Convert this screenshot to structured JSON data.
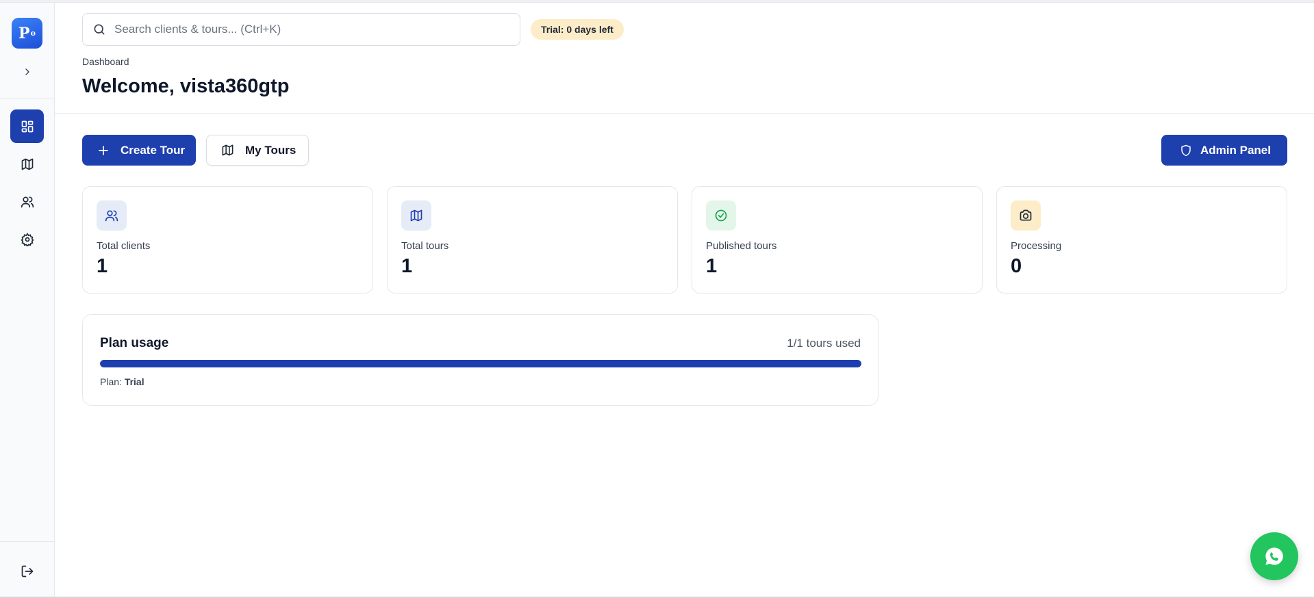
{
  "app": {
    "logo_text": "P",
    "logo_sup": "o"
  },
  "sidebar": {
    "items": [
      {
        "name": "dashboard",
        "icon": "layout-dashboard-icon",
        "active": true
      },
      {
        "name": "tours",
        "icon": "map-icon",
        "active": false
      },
      {
        "name": "clients",
        "icon": "users-icon",
        "active": false
      },
      {
        "name": "settings",
        "icon": "gear-icon",
        "active": false
      }
    ],
    "logout_icon": "log-out-icon"
  },
  "header": {
    "search_placeholder": "Search clients & tours... (Ctrl+K)",
    "search_value": "",
    "trial_badge": "Trial: 0 days left",
    "breadcrumb": "Dashboard",
    "title": "Welcome, vista360gtp"
  },
  "actions": {
    "create_tour": "Create Tour",
    "my_tours": "My Tours",
    "admin_panel": "Admin Panel"
  },
  "stats": [
    {
      "label": "Total clients",
      "value": "1",
      "icon": "users-icon",
      "color": "#1e40af",
      "bg": "#e6ebf8"
    },
    {
      "label": "Total tours",
      "value": "1",
      "icon": "map-icon",
      "color": "#1e40af",
      "bg": "#e6ebf8"
    },
    {
      "label": "Published tours",
      "value": "1",
      "icon": "check-circle-icon",
      "color": "#16a34a",
      "bg": "#e4f6ea"
    },
    {
      "label": "Processing",
      "value": "0",
      "icon": "camera-icon",
      "color": "#1f2937",
      "bg": "#fdecc8"
    }
  ],
  "plan": {
    "title": "Plan usage",
    "usage_text": "1/1 tours used",
    "plan_prefix": "Plan:",
    "plan_name": "Trial",
    "used": 1,
    "limit": 1
  },
  "colors": {
    "primary": "#1e40af",
    "whatsapp": "#22c55e",
    "badge_bg": "#fdecc8"
  },
  "chat": {
    "icon": "whatsapp-icon"
  }
}
